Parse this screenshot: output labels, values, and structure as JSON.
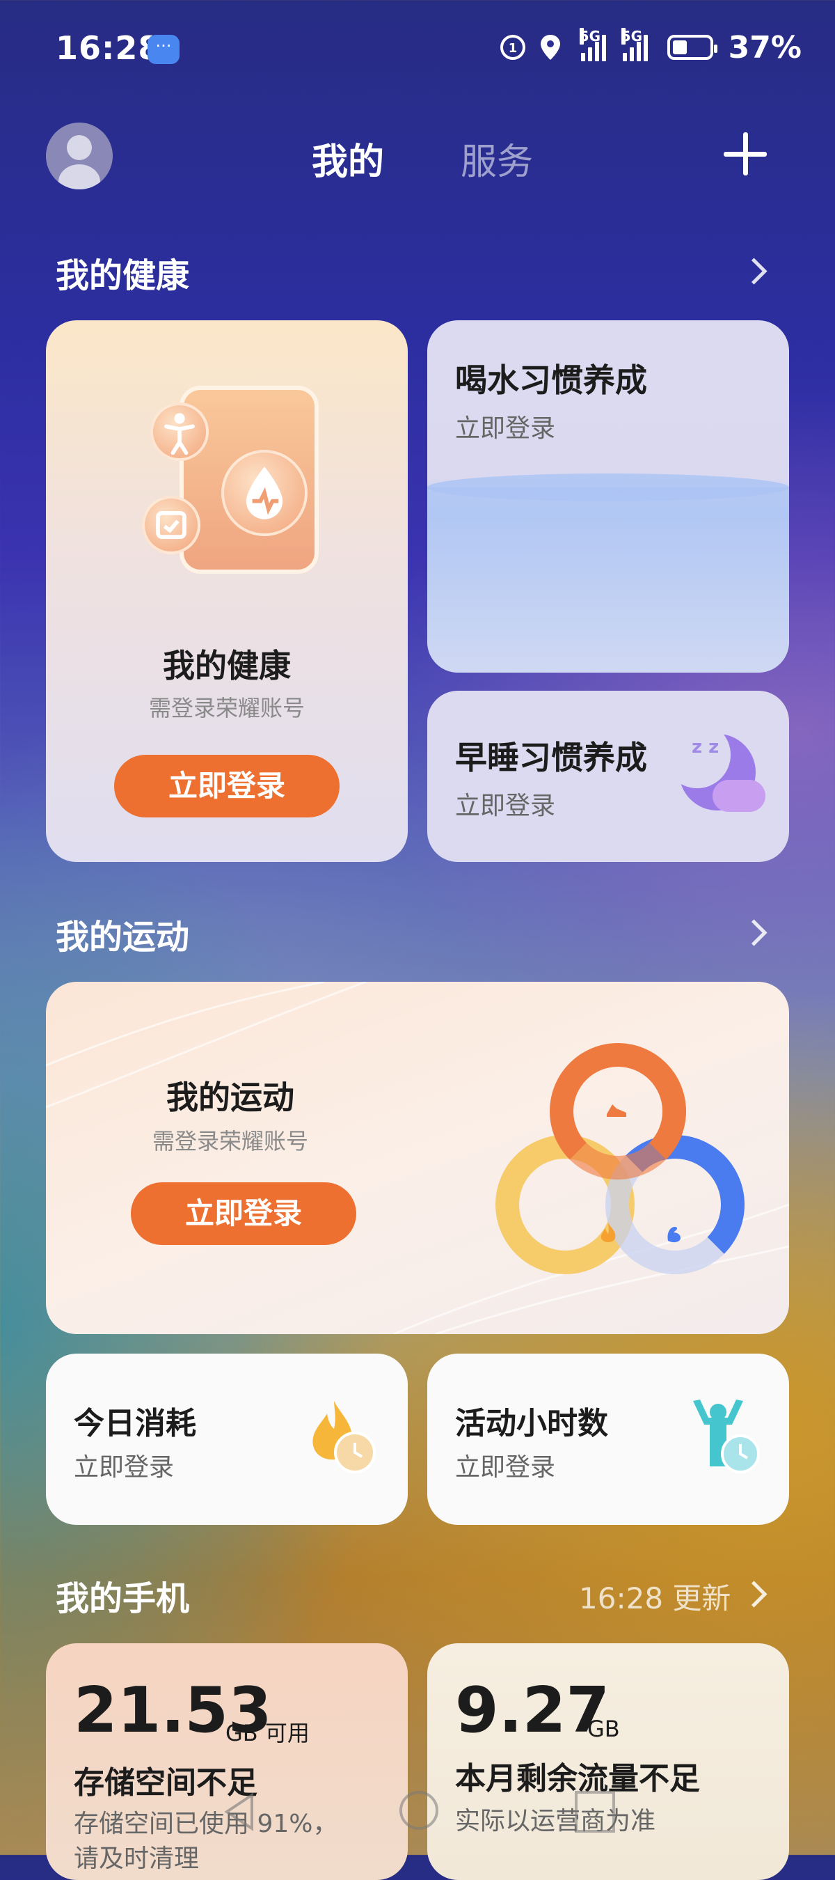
{
  "status_bar": {
    "time": "16:28",
    "battery": "37%",
    "network_1": "5G",
    "network_2": "5G"
  },
  "header": {
    "tab_mine": "我的",
    "tab_service": "服务"
  },
  "health": {
    "section_title": "我的健康",
    "main_card": {
      "title": "我的健康",
      "subtitle": "需登录荣耀账号",
      "button": "立即登录"
    },
    "water_card": {
      "title": "喝水习惯养成",
      "subtitle": "立即登录"
    },
    "sleep_card": {
      "title": "早睡习惯养成",
      "subtitle": "立即登录"
    }
  },
  "sport": {
    "section_title": "我的运动",
    "main_card": {
      "title": "我的运动",
      "subtitle": "需登录荣耀账号",
      "button": "立即登录"
    },
    "calories_card": {
      "title": "今日消耗",
      "subtitle": "立即登录"
    },
    "active_hours_card": {
      "title": "活动小时数",
      "subtitle": "立即登录"
    }
  },
  "phone": {
    "section_title": "我的手机",
    "update_text": "16:28 更新",
    "storage_card": {
      "value": "21.53",
      "unit": "GB 可用",
      "title": "存储空间不足",
      "desc_line1": "存储空间已使用 91%，",
      "desc_line2": "请及时清理"
    },
    "data_card": {
      "value": "9.27",
      "unit": "GB",
      "title": "本月剩余流量不足",
      "desc": "实际以运营商为准"
    }
  },
  "colors": {
    "accent_orange": "#ee7030",
    "card_title": "#1c1c1c",
    "card_subtitle": "#666666"
  },
  "icons": [
    "message-icon",
    "location-icon",
    "signal-icon",
    "battery-icon",
    "avatar-icon",
    "plus-icon",
    "chevron-right-icon",
    "water-drop-icon",
    "moon-icon",
    "flame-icon",
    "person-icon"
  ]
}
